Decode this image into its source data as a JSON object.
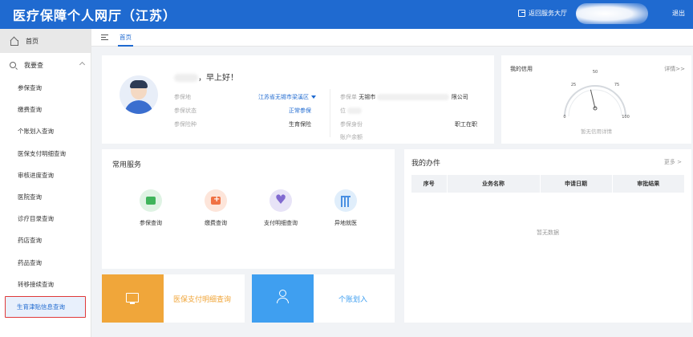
{
  "header": {
    "title": "医疗保障个人网厅（江苏）",
    "back_label": "返回服务大厅",
    "logout_label": "退出"
  },
  "sidebar": {
    "home_label": "首页",
    "group_label": "我要查",
    "items": [
      {
        "label": "参保查询"
      },
      {
        "label": "缴费查询"
      },
      {
        "label": "个账划入查询"
      },
      {
        "label": "医保支付明细查询"
      },
      {
        "label": "审核进度查询"
      },
      {
        "label": "医院查询"
      },
      {
        "label": "诊疗目录查询"
      },
      {
        "label": "药店查询"
      },
      {
        "label": "药品查询"
      },
      {
        "label": "转移接续查询"
      },
      {
        "label": "生育津贴信息查询"
      }
    ]
  },
  "tabs": {
    "home": "首页"
  },
  "profile": {
    "greeting": "，早上好！",
    "left": [
      {
        "key": "参保地",
        "value": "江苏省无锡市梁溪区"
      },
      {
        "key": "参保状态",
        "value": "正常参保"
      },
      {
        "key": "参保险种",
        "value": "生育保险"
      }
    ],
    "right": [
      {
        "key": "参保单",
        "value": "无锡市",
        "value2": "限公司"
      },
      {
        "key": "位",
        "value": ""
      },
      {
        "key": "参保身份",
        "value": "职工在职"
      },
      {
        "key": "账户余额",
        "value": ""
      }
    ]
  },
  "credit": {
    "title": "我的信用",
    "more": "详情>>",
    "ticks": [
      "0",
      "25",
      "50",
      "75",
      "100"
    ],
    "value": 45,
    "empty": "暂无信用详情"
  },
  "services": {
    "title": "常用服务",
    "items": [
      {
        "label": "参保查询"
      },
      {
        "label": "缴费查询"
      },
      {
        "label": "支付明细查询"
      },
      {
        "label": "异地就医"
      }
    ]
  },
  "tiles": [
    {
      "label": "医保支付明细查询",
      "color": "#f0a63a"
    },
    {
      "label": "个账划入",
      "color": "#3f9ff0"
    }
  ],
  "myjobs": {
    "title": "我的办件",
    "more": "更多 >",
    "columns": [
      "序号",
      "业务名称",
      "申请日期",
      "审批结果"
    ],
    "empty": "暂无数据"
  }
}
